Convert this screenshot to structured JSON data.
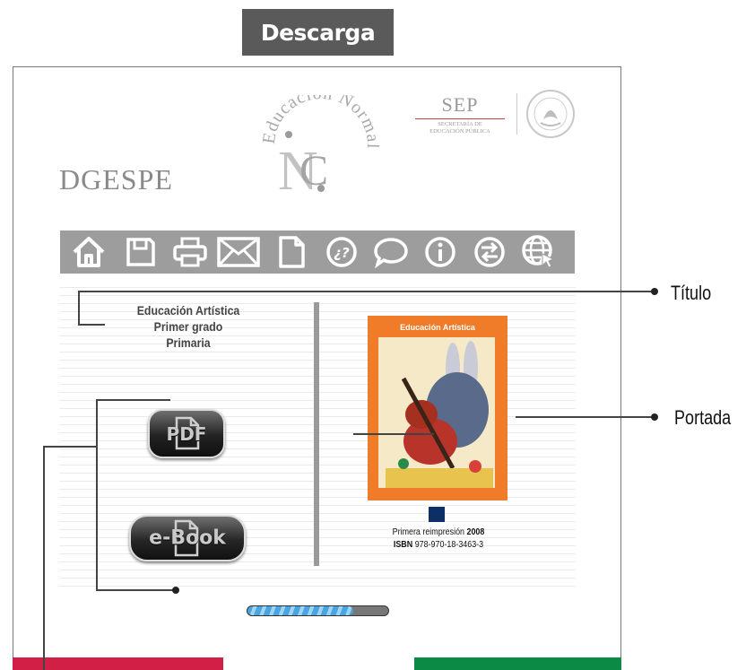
{
  "header": {
    "download_label": "Descarga"
  },
  "logos": {
    "dgespe": "DGESPE",
    "sep_title": "SEP",
    "sep_subtitle_1": "SECRETARÍA DE",
    "sep_subtitle_2": "EDUCACIÓN PÚBLICA",
    "normal_logo_text": "Educación Normal"
  },
  "toolbar": {
    "icons": [
      "home-icon",
      "save-icon",
      "print-icon",
      "mail-icon",
      "document-icon",
      "help-icon",
      "chat-icon",
      "info-icon",
      "navigate-icon",
      "globe-icon"
    ]
  },
  "book": {
    "title_line1": "Educación Artística",
    "title_line2": "Primer grado",
    "title_line3": "Primaria",
    "cover_title": "Educación Artística",
    "reprint_label": "Primera reimpresión",
    "reprint_year": "2008",
    "isbn_label": "ISBN",
    "isbn_value": "978-970-18-3463-3"
  },
  "buttons": {
    "pdf_label": "PDF",
    "ebook_label": "e-Book"
  },
  "progress": {
    "value": 0.75
  },
  "callouts": {
    "titulo": "Título",
    "portada": "Portada"
  },
  "colors": {
    "header_bg": "#5a5a5a",
    "toolbar_bg": "#9d9d9d",
    "cover_orange": "#f07c2a",
    "marker_blue": "#0c2f66",
    "bar_red": "#d11f45",
    "bar_green": "#0a8a44"
  }
}
